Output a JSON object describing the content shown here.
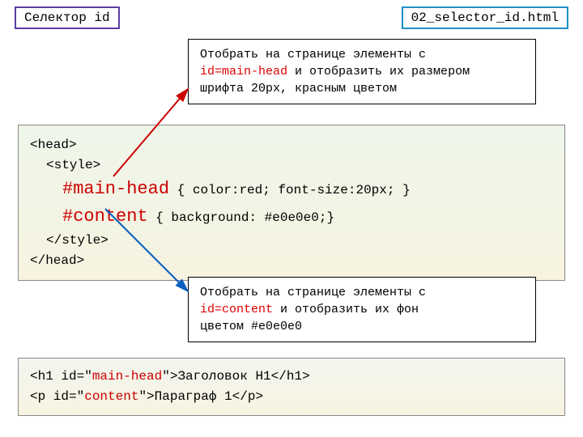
{
  "title": "Селектор id",
  "filename": "02_selector_id.html",
  "callout_top": {
    "line1_a": "Отобрать на странице  элементы с",
    "id": "id=main-head",
    "line2": "  и отобразить их размером",
    "line3": "шрифта 20px, красным цветом"
  },
  "callout_bottom": {
    "line1_a": "Отобрать на странице  элементы с",
    "id": "id=content",
    "line2": " и отобразить их фон",
    "line3": "цветом #e0e0e0"
  },
  "code_main": {
    "l1": "<head>",
    "l2": "<style>",
    "sel1": "#main-head",
    "rule1": " { color:red;  font-size:20px;  }",
    "sel2": "#content",
    "rule2": " { background: #e0e0e0;}",
    "l5": "</style>",
    "l6": "</head>"
  },
  "code_bottom": {
    "p1a": "<h1 id=\"",
    "p1id": "main-head",
    "p1b": "\">Заголовок H1</h1>",
    "p2a": "<p id=\"",
    "p2id": "content",
    "p2b": "\">Параграф  1</p>"
  }
}
